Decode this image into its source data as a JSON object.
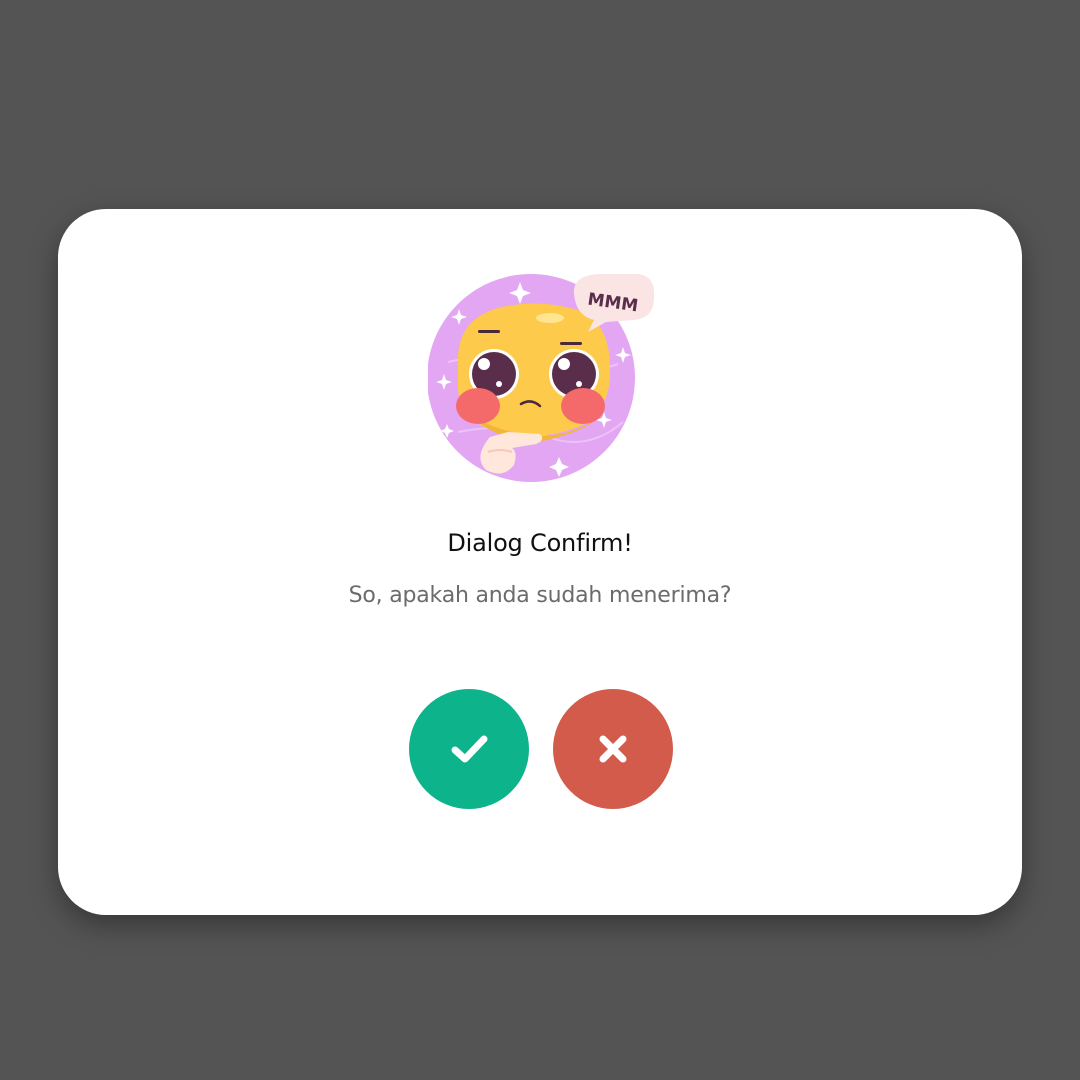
{
  "dialog": {
    "title": "Dialog Confirm!",
    "message": "So, apakah anda sudah menerima?",
    "illustration": {
      "icon": "thinking-face-icon",
      "speech_bubble_text": "MMM"
    },
    "buttons": {
      "accept": {
        "icon": "check-icon",
        "color": "#0db38a"
      },
      "reject": {
        "icon": "close-icon",
        "color": "#d35b4b"
      }
    }
  },
  "colors": {
    "backdrop": "#545454",
    "card": "#ffffff",
    "title": "#111111",
    "message": "#6b6b6b"
  }
}
